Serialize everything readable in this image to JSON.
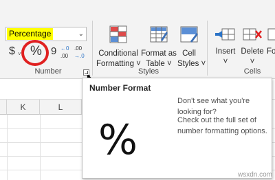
{
  "number_group": {
    "format_value": "Percentage",
    "dropdown_arrow": "⌄",
    "currency_symbol": "$",
    "percent_symbol": "%",
    "comma_symbol": "9",
    "increase_decimal": {
      "top": "←0",
      "bottom": ".00"
    },
    "decrease_decimal": {
      "top": ".00",
      "bottom": "→.0"
    },
    "label": "Number"
  },
  "styles_group": {
    "conditional_formatting": {
      "line1": "Conditional",
      "line2": "Formatting ˅"
    },
    "format_as_table": {
      "line1": "Format as",
      "line2": "Table ˅"
    },
    "cell_styles": {
      "line1": "Cell",
      "line2": "Styles ˅"
    },
    "label": "Styles"
  },
  "cells_group": {
    "insert": {
      "line1": "Insert",
      "line2": "˅"
    },
    "delete": {
      "line1": "Delete",
      "line2": "˅"
    },
    "format": {
      "line1": "Fo",
      "line2": ""
    },
    "label": "Cells"
  },
  "sheet": {
    "columns": [
      "K",
      "L"
    ]
  },
  "tooltip": {
    "title": "Number Format",
    "big_symbol": "%",
    "line1": "Don't see what you're looking for?",
    "line2": "Check out the full set of number formatting options."
  },
  "watermark": "wsxdn.com",
  "colors": {
    "highlight": "#ffff00",
    "circle": "#e02020",
    "accent_blue": "#2b73c6",
    "accent_red": "#e02020"
  }
}
